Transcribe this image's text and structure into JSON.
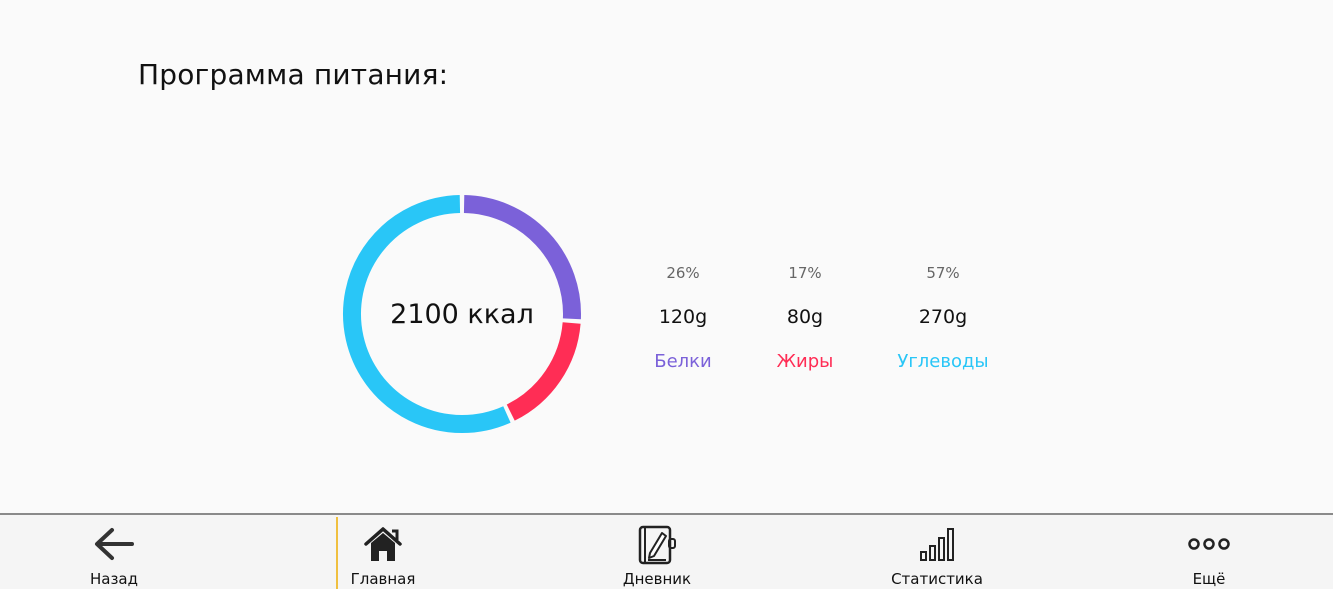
{
  "page": {
    "title": "Программа питания:"
  },
  "summary": {
    "calories_label": "2100 ккал"
  },
  "chart_data": {
    "type": "pie",
    "variant": "donut",
    "center_label": "2100 ккал",
    "slices": [
      {
        "name": "Белки",
        "percent": 26,
        "percent_label": "26%",
        "grams_label": "120g",
        "color": "#7b61d9"
      },
      {
        "name": "Жиры",
        "percent": 17,
        "percent_label": "17%",
        "grams_label": "80g",
        "color": "#ff2d55"
      },
      {
        "name": "Углеводы",
        "percent": 57,
        "percent_label": "57%",
        "grams_label": "270g",
        "color": "#29c6f7"
      }
    ]
  },
  "nav": {
    "items": [
      {
        "label": "Назад",
        "icon": "arrow-left-icon",
        "active": false
      },
      {
        "label": "Главная",
        "icon": "home-icon",
        "active": true
      },
      {
        "label": "Дневник",
        "icon": "diary-icon",
        "active": false
      },
      {
        "label": "Статистика",
        "icon": "bar-chart-icon",
        "active": false
      },
      {
        "label": "Ещё",
        "icon": "more-dots-icon",
        "active": false
      }
    ]
  },
  "colors": {
    "protein": "#7b61d9",
    "fat": "#ff2d55",
    "carbs": "#29c6f7",
    "active_marker": "#f0c040"
  }
}
